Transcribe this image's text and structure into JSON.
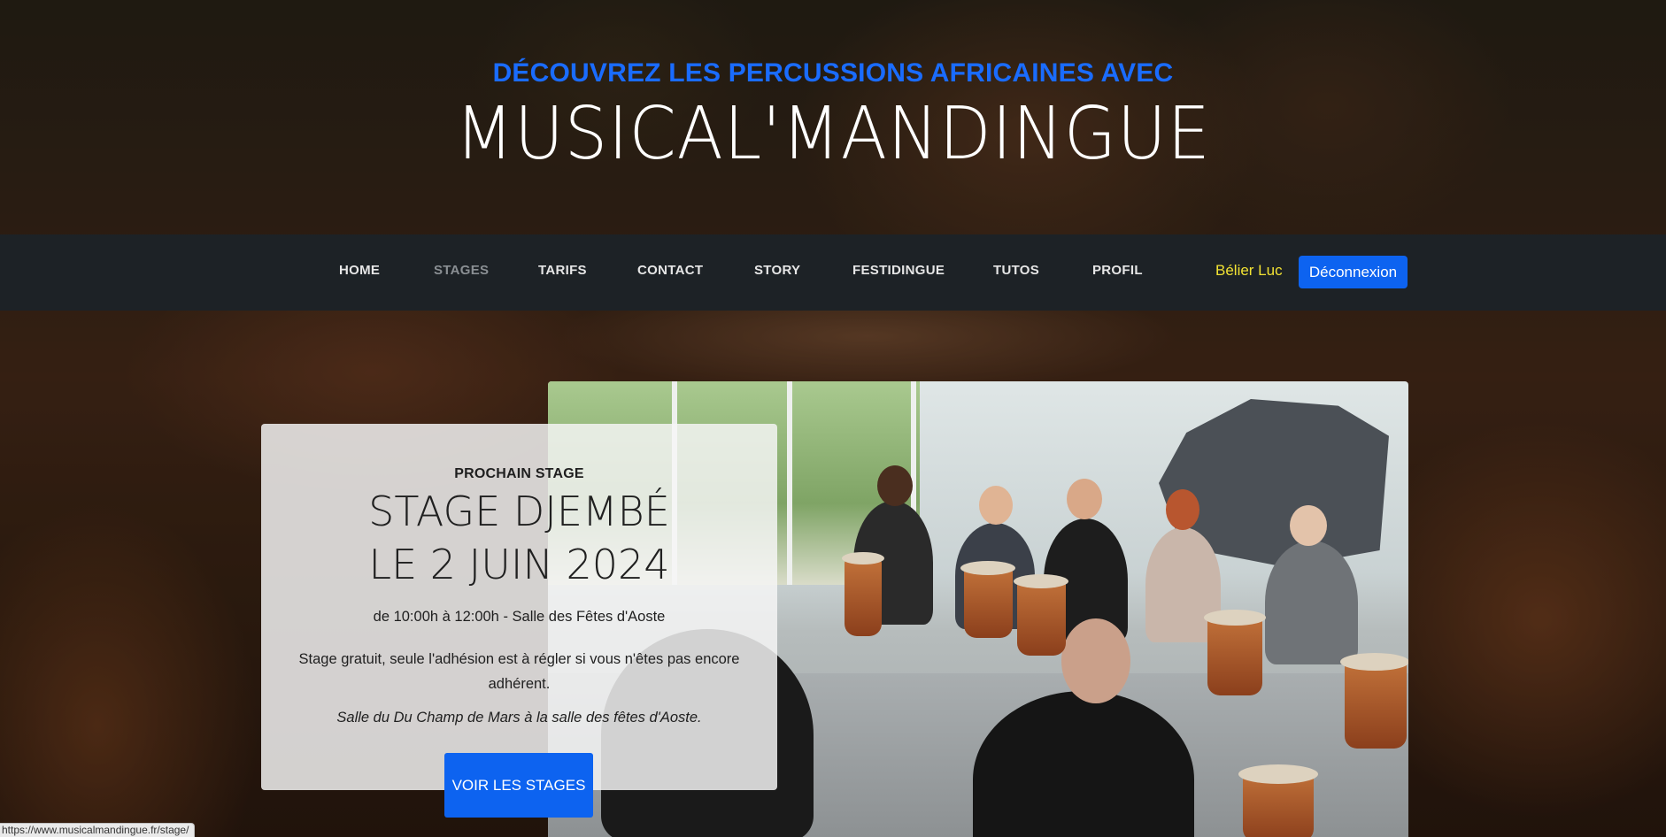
{
  "hero": {
    "subtitle": "DÉCOUVREZ LES PERCUSSIONS AFRICAINES AVEC",
    "title": "MUSICAL'MANDINGUE"
  },
  "nav": {
    "items": [
      {
        "label": "HOME",
        "active": false
      },
      {
        "label": "STAGES",
        "active": true
      },
      {
        "label": "TARIFS",
        "active": false
      },
      {
        "label": "CONTACT",
        "active": false
      },
      {
        "label": "STORY",
        "active": false
      },
      {
        "label": "FESTIDINGUE",
        "active": false
      },
      {
        "label": "TUTOS",
        "active": false
      },
      {
        "label": "PROFIL",
        "active": false
      }
    ],
    "user_name": "Bélier Luc",
    "logout_label": "Déconnexion"
  },
  "card": {
    "label": "PROCHAIN STAGE",
    "title_line1": "STAGE DJEMBÉ",
    "title_line2": "LE 2 JUIN 2024",
    "time": "de 10:00h à 12:00h - Salle des Fêtes d'Aoste",
    "description": "Stage gratuit, seule l'adhésion est à  régler si vous n'êtes pas encore adhérent.",
    "place": "Salle du Du Champ de Mars à la salle des fêtes d'Aoste.",
    "button_label": "VOIR LES STAGES"
  },
  "status_url": "https://www.musicalmandingue.fr/stage/",
  "colors": {
    "accent_blue": "#0d63f0",
    "subtitle_blue": "#1a6cff",
    "navbar_bg": "#1d2226",
    "user_yellow": "#f2e233"
  }
}
